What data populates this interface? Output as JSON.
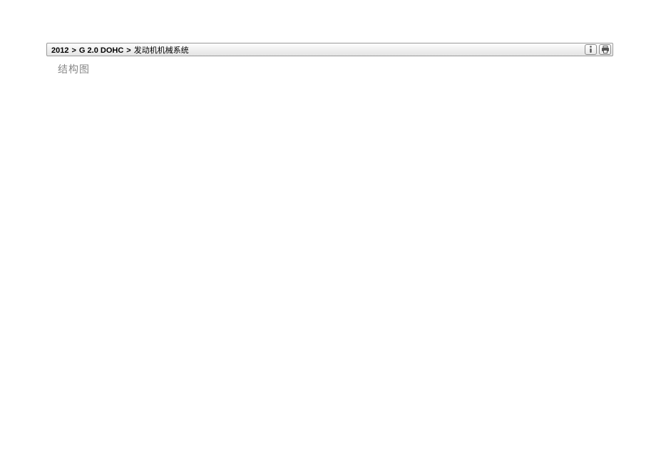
{
  "breadcrumb": {
    "year": "2012",
    "sep1": ">",
    "engine": "G 2.0 DOHC",
    "sep2": ">",
    "system": "发动机机械系统"
  },
  "section_title": "结构图"
}
